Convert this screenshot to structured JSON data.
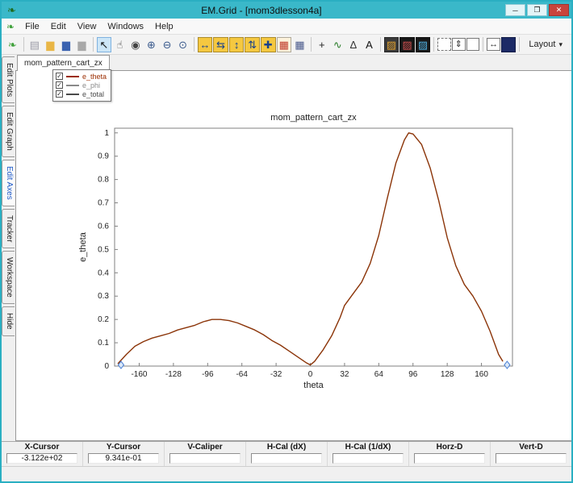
{
  "window": {
    "title": "EM.Grid - [mom3dlesson4a]",
    "icon_glyph": "❧",
    "titlebar_color": "#3ab8c9",
    "buttons": {
      "minimize": "─",
      "maximize": "❐",
      "close": "✕"
    }
  },
  "menu": {
    "items": [
      "File",
      "Edit",
      "View",
      "Windows",
      "Help"
    ]
  },
  "toolbar": {
    "items": [
      {
        "name": "app-leaf-icon",
        "glyph": "❧",
        "fg": "#3fa13b"
      },
      {
        "name": "sep"
      },
      {
        "name": "new-file-icon",
        "glyph": "▤",
        "fg": "#9a9aa6"
      },
      {
        "name": "open-folder-icon",
        "glyph": "▆",
        "fg": "#e9b646"
      },
      {
        "name": "save-icon",
        "glyph": "▆",
        "fg": "#3a62b0"
      },
      {
        "name": "print-icon",
        "glyph": "▆",
        "fg": "#a8a8a8"
      },
      {
        "name": "sep"
      },
      {
        "name": "select-cursor-icon",
        "glyph": "↖",
        "fg": "#111111",
        "active": true
      },
      {
        "name": "pan-hand-icon",
        "glyph": "☝",
        "fg": "#444444"
      },
      {
        "name": "track-cursor-icon",
        "glyph": "◉",
        "fg": "#444444"
      },
      {
        "name": "zoom-in-icon",
        "glyph": "⊕",
        "fg": "#3a5a8c"
      },
      {
        "name": "zoom-out-icon",
        "glyph": "⊖",
        "fg": "#3a5a8c"
      },
      {
        "name": "zoom-window-icon",
        "glyph": "⊙",
        "fg": "#3a5a8c"
      },
      {
        "name": "sep"
      },
      {
        "name": "x-full-scale-icon",
        "glyph": "↔",
        "fg": "#18418c",
        "bg": "#f5c840"
      },
      {
        "name": "x-expand-icon",
        "glyph": "⇆",
        "fg": "#18418c",
        "bg": "#f5c840"
      },
      {
        "name": "y-full-scale-icon",
        "glyph": "↕",
        "fg": "#18418c",
        "bg": "#f5c840"
      },
      {
        "name": "y-expand-icon",
        "glyph": "⇅",
        "fg": "#18418c",
        "bg": "#f5c840"
      },
      {
        "name": "xy-full-scale-icon",
        "glyph": "✚",
        "fg": "#18418c",
        "bg": "#f5c840"
      },
      {
        "name": "autoscale-plot-icon",
        "glyph": "▦",
        "fg": "#c03a2a",
        "bg": "#fdf3dc"
      },
      {
        "name": "grid-toggle-icon",
        "glyph": "▦",
        "fg": "#4a5a8c"
      },
      {
        "name": "sep"
      },
      {
        "name": "add-cursor-icon",
        "glyph": "+",
        "fg": "#222222"
      },
      {
        "name": "curve-fit-icon",
        "glyph": "∿",
        "fg": "#2a7d2a"
      },
      {
        "name": "delta-marker-icon",
        "glyph": "Δ",
        "fg": "#333333"
      },
      {
        "name": "text-annotation-icon",
        "glyph": "A",
        "fg": "#111111"
      },
      {
        "name": "sep"
      },
      {
        "name": "colormap-image-icon",
        "glyph": "▨",
        "fg": "#e0a030",
        "bg": "#3a3a3a"
      },
      {
        "name": "image-plot-icon",
        "glyph": "▨",
        "fg": "#d05050",
        "bg": "#181818"
      },
      {
        "name": "surface-plot-icon",
        "glyph": "▨",
        "fg": "#50b0e0",
        "bg": "#181818"
      },
      {
        "name": "sep"
      },
      {
        "name": "select-region-icon",
        "glyph": "",
        "dashed": true
      },
      {
        "name": "v-caliper-icon",
        "glyph": "⇕",
        "fg": "#333333",
        "boxed": true
      },
      {
        "name": "annotation-box-icon",
        "glyph": "",
        "boxed": true
      },
      {
        "name": "sep"
      },
      {
        "name": "h-caliper-icon",
        "glyph": "↔",
        "fg": "#333333",
        "boxed": true
      },
      {
        "name": "line-color-swatch",
        "glyph": "",
        "bg": "#1c2a66"
      },
      {
        "name": "sep"
      },
      {
        "name": "layout-dropdown",
        "type": "dropdown",
        "label": "Layout",
        "caret": "▾"
      }
    ]
  },
  "sidebar": {
    "tabs": [
      {
        "label": "Edit Plots"
      },
      {
        "label": "Edit Graph"
      },
      {
        "label": "Edit Axes",
        "active": true
      },
      {
        "label": "Tracker"
      },
      {
        "label": "Workspace"
      },
      {
        "label": "Hide"
      }
    ]
  },
  "doc_tab": "mom_pattern_cart_zx",
  "legend": {
    "check_glyph": "✓",
    "items": [
      {
        "label": "e_theta",
        "color": "#9b2d00",
        "checked": true
      },
      {
        "label": "e_phi",
        "color": "#8a8a8a",
        "checked": true
      },
      {
        "label": "e_total",
        "color": "#4a4a4a",
        "checked": true
      }
    ]
  },
  "chart_data": {
    "type": "line",
    "title": "mom_pattern_cart_zx",
    "xlabel": "theta",
    "ylabel": "e_theta",
    "xlim": [
      -183,
      189
    ],
    "ylim": [
      0,
      1.02
    ],
    "x_ticks": [
      -160,
      -128,
      -96,
      -64,
      -32,
      0,
      32,
      64,
      96,
      128,
      160
    ],
    "y_ticks": [
      0,
      0.1,
      0.2,
      0.3,
      0.4,
      0.5,
      0.6,
      0.7,
      0.8,
      0.9,
      1
    ],
    "grid": false,
    "legend_position": "top-left",
    "axis_color": "#808080",
    "text_color": "#222222",
    "series": [
      {
        "name": "e_theta",
        "color": "#8b3408",
        "x": [
          -180,
          -172,
          -164,
          -156,
          -148,
          -140,
          -132,
          -124,
          -116,
          -108,
          -100,
          -92,
          -84,
          -76,
          -68,
          -60,
          -52,
          -44,
          -36,
          -28,
          -20,
          -12,
          -4,
          0,
          4,
          12,
          20,
          28,
          32,
          40,
          48,
          56,
          64,
          72,
          80,
          88,
          92,
          96,
          104,
          112,
          120,
          128,
          136,
          144,
          152,
          160,
          168,
          176,
          180
        ],
        "y": [
          0.01,
          0.05,
          0.085,
          0.105,
          0.12,
          0.13,
          0.14,
          0.155,
          0.165,
          0.175,
          0.19,
          0.2,
          0.2,
          0.195,
          0.185,
          0.17,
          0.155,
          0.135,
          0.11,
          0.09,
          0.065,
          0.04,
          0.015,
          0.005,
          0.02,
          0.07,
          0.13,
          0.21,
          0.26,
          0.31,
          0.36,
          0.44,
          0.56,
          0.72,
          0.87,
          0.97,
          1,
          0.995,
          0.95,
          0.85,
          0.71,
          0.55,
          0.43,
          0.35,
          0.3,
          0.235,
          0.15,
          0.05,
          0.02
        ]
      }
    ],
    "cursor_markers": [
      {
        "x": -177,
        "y": 0.005
      },
      {
        "x": 184,
        "y": 0.005
      }
    ],
    "marker_color": "#4a7fd4"
  },
  "status_bar": {
    "columns": [
      {
        "header": "X-Cursor",
        "value": "-3.122e+02"
      },
      {
        "header": "Y-Cursor",
        "value": "9.341e-01"
      },
      {
        "header": "V-Caliper",
        "value": ""
      },
      {
        "header": "H-Cal (dX)",
        "value": ""
      },
      {
        "header": "H-Cal (1/dX)",
        "value": ""
      },
      {
        "header": "Horz-D",
        "value": ""
      },
      {
        "header": "Vert-D",
        "value": ""
      }
    ]
  }
}
